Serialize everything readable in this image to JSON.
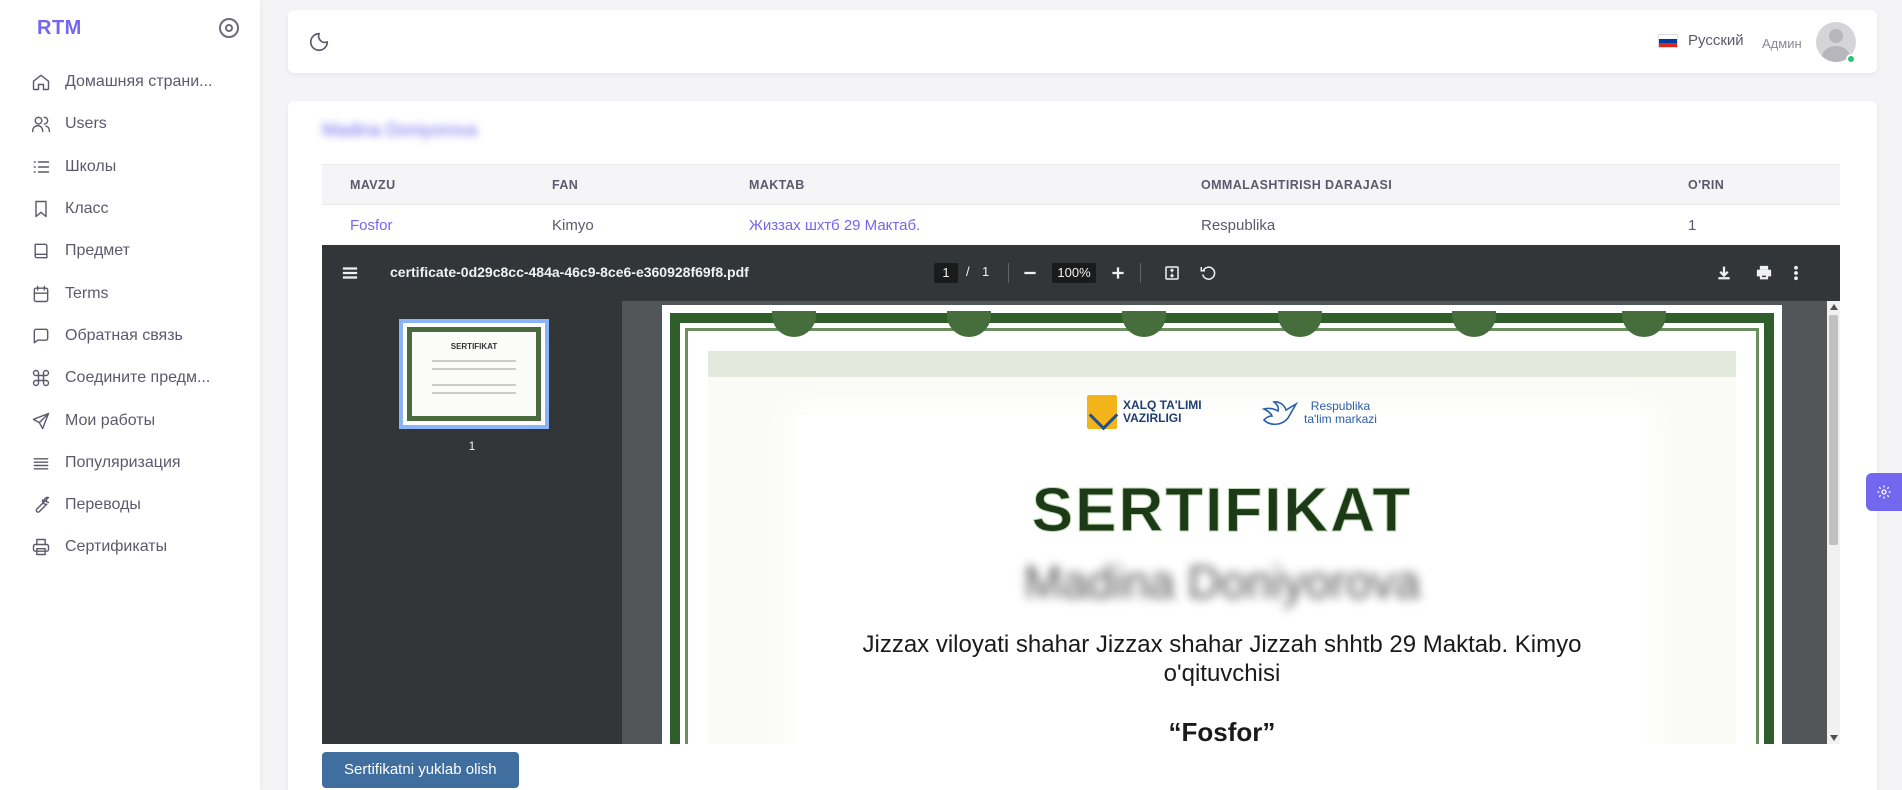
{
  "sidebar": {
    "brand": "RTM",
    "items": [
      {
        "label": "Домашняя страни...",
        "icon": "home-icon"
      },
      {
        "label": "Users",
        "icon": "users-icon"
      },
      {
        "label": "Школы",
        "icon": "list-icon"
      },
      {
        "label": "Класс",
        "icon": "bookmark-icon"
      },
      {
        "label": "Предмет",
        "icon": "book-icon"
      },
      {
        "label": "Terms",
        "icon": "calendar-icon"
      },
      {
        "label": "Обратная связь",
        "icon": "message-icon"
      },
      {
        "label": "Соедините предм...",
        "icon": "command-icon"
      },
      {
        "label": "Мои работы",
        "icon": "send-icon"
      },
      {
        "label": "Популяризация",
        "icon": "lines-icon"
      },
      {
        "label": "Переводы",
        "icon": "wrench-icon"
      },
      {
        "label": "Сертификаты",
        "icon": "printer-icon"
      }
    ]
  },
  "navbar": {
    "language": "Русский",
    "role": "Админ"
  },
  "main": {
    "person_name": "Madina Doniyorova",
    "table": {
      "headers": [
        "MAVZU",
        "FAN",
        "MAKTAB",
        "OMMALASHTIRISH DARAJASI",
        "O'RIN"
      ],
      "rows": [
        [
          "Fosfor",
          "Kimyo",
          "Жиззах шхтб 29 Мактаб.",
          "Respublika",
          "1"
        ]
      ]
    },
    "download_label": "Sertifikatni yuklab olish"
  },
  "pdf": {
    "filename": "certificate-0d29c8cc-484a-46c9-8ce6-e360928f69f8.pdf",
    "page_current": "1",
    "page_sep": "/",
    "page_total": "1",
    "zoom": "100%",
    "thumb_number": "1",
    "thumb_title": "SERTIFIKAT"
  },
  "certificate": {
    "logo1_line1": "XALQ TA'LIMI",
    "logo1_line2": "VAZIRLIGI",
    "logo2_line1": "Respublika",
    "logo2_line2": "ta'lim markazi",
    "title": "SERTIFIKAT",
    "name": "Madina Doniyorova",
    "description": "Jizzax viloyati shahar Jizzax shahar Jizzah shhtb 29 Maktab. Kimyo o'qituvchisi",
    "topic": "“Fosfor”"
  },
  "colors": {
    "accent": "#7367f0",
    "button": "#3f6e9f",
    "pdf_toolbar": "#323639",
    "certificate_border": "#2f5e2a"
  }
}
